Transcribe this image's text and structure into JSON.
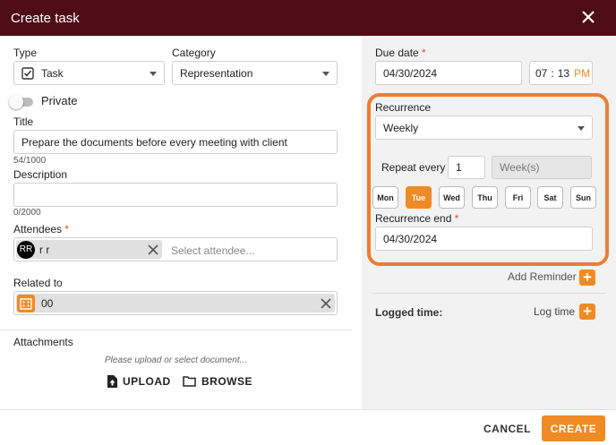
{
  "header": {
    "title": "Create task"
  },
  "left": {
    "type_label": "Type",
    "type_value": "Task",
    "category_label": "Category",
    "category_value": "Representation",
    "private_label": "Private",
    "title_label": "Title",
    "title_value": "Prepare the documents before every meeting with client",
    "title_counter": "54/1000",
    "description_label": "Description",
    "description_value": "",
    "description_counter": "0/2000",
    "attendees_label": "Attendees",
    "attendee_initials": "RR",
    "attendee_name": "r r",
    "attendee_placeholder": "Select attendee...",
    "related_label": "Related to",
    "related_value": "00",
    "attachments_label": "Attachments",
    "upload_hint": "Please upload or select document...",
    "upload_label": "UPLOAD",
    "browse_label": "BROWSE"
  },
  "right": {
    "due_label": "Due date",
    "due_date": "04/30/2024",
    "time_hour": "07",
    "time_sep": ":",
    "time_min": "13",
    "time_ampm": "PM",
    "recurrence_label": "Recurrence",
    "recurrence_value": "Weekly",
    "repeat_label": "Repeat every",
    "repeat_value": "1",
    "repeat_unit": "Week(s)",
    "days": [
      "Mon",
      "Tue",
      "Wed",
      "Thu",
      "Fri",
      "Sat",
      "Sun"
    ],
    "active_day": "Tue",
    "recurrence_end_label": "Recurrence end",
    "recurrence_end_value": "04/30/2024",
    "add_reminder_label": "Add Reminder",
    "logged_time_label": "Logged time:",
    "log_time_label": "Log time"
  },
  "footer": {
    "cancel_label": "CANCEL",
    "create_label": "CREATE"
  },
  "colors": {
    "header_bg": "#4e0d16",
    "accent": "#f08a24",
    "highlight": "#ee7d32",
    "required": "#e0492a"
  },
  "icons": [
    "close-icon",
    "checkbox-icon",
    "chevron-down-icon",
    "remove-icon",
    "building-icon",
    "upload-file-icon",
    "folder-icon",
    "plus-icon"
  ]
}
